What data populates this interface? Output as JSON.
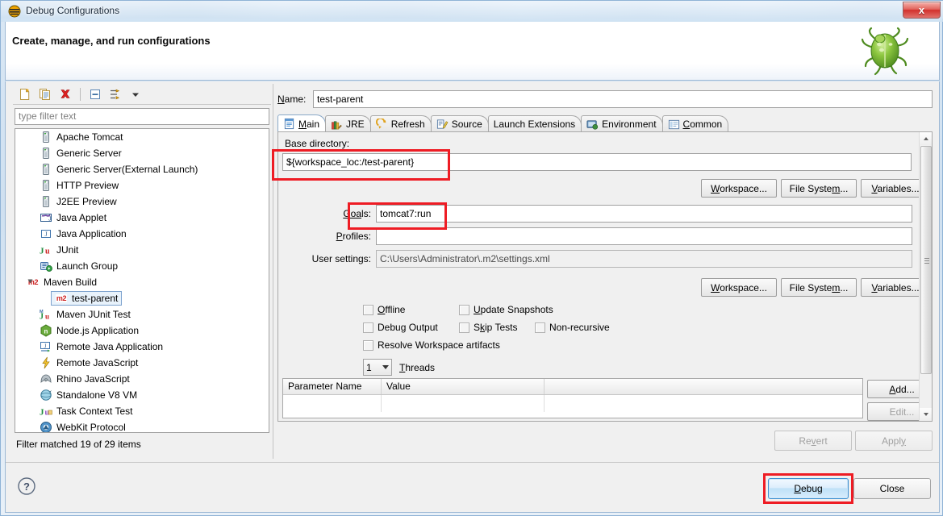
{
  "window": {
    "title": "Debug Configurations",
    "title_icon": "eclipse-debug-icon",
    "close_label": "x"
  },
  "header": {
    "title": "Create, manage, and run configurations",
    "icon": "green-bug-icon"
  },
  "tree_toolbar": {
    "buttons": [
      {
        "name": "new-launch-configuration-icon",
        "label": "New"
      },
      {
        "name": "duplicate-configuration-icon",
        "label": "Duplicate"
      },
      {
        "name": "delete-configuration-icon",
        "label": "Delete"
      },
      {
        "name": "collapse-all-icon",
        "label": "Collapse All"
      },
      {
        "name": "filter-icon",
        "label": "Filter"
      },
      {
        "name": "view-menu-chevron-down-icon",
        "label": "View Menu"
      }
    ]
  },
  "filter": {
    "placeholder": "type filter text",
    "value": ""
  },
  "tree": {
    "items": [
      {
        "label": "Apache Tomcat",
        "icon": "server-icon",
        "level": 0
      },
      {
        "label": "Generic Server",
        "icon": "server-icon",
        "level": 0
      },
      {
        "label": "Generic Server(External Launch)",
        "icon": "server-icon",
        "level": 0
      },
      {
        "label": "HTTP Preview",
        "icon": "server-icon",
        "level": 0
      },
      {
        "label": "J2EE Preview",
        "icon": "server-icon",
        "level": 0
      },
      {
        "label": "Java Applet",
        "icon": "java-applet-icon",
        "level": 0
      },
      {
        "label": "Java Application",
        "icon": "java-application-icon",
        "level": 0
      },
      {
        "label": "JUnit",
        "icon": "junit-icon",
        "level": 0
      },
      {
        "label": "Launch Group",
        "icon": "launch-group-icon",
        "level": 0
      },
      {
        "label": "Maven Build",
        "icon": "maven-icon",
        "level": 0,
        "expanded": true
      },
      {
        "label": "test-parent",
        "icon": "maven-icon",
        "level": 1,
        "selected": true
      },
      {
        "label": "Maven JUnit Test",
        "icon": "maven-junit-icon",
        "level": 0
      },
      {
        "label": "Node.js Application",
        "icon": "nodejs-icon",
        "level": 0
      },
      {
        "label": "Remote Java Application",
        "icon": "remote-java-icon",
        "level": 0
      },
      {
        "label": "Remote JavaScript",
        "icon": "remote-javascript-icon",
        "level": 0
      },
      {
        "label": "Rhino JavaScript",
        "icon": "rhino-icon",
        "level": 0
      },
      {
        "label": "Standalone V8 VM",
        "icon": "v8-vm-icon",
        "level": 0
      },
      {
        "label": "Task Context Test",
        "icon": "task-context-junit-icon",
        "level": 0
      },
      {
        "label": "WebKit Protocol",
        "icon": "webkit-icon",
        "level": 0
      }
    ],
    "status": "Filter matched 19 of 29 items"
  },
  "config": {
    "name_label": "Name:",
    "name_value": "test-parent",
    "tabs": [
      {
        "label": "Main",
        "icon": "main-tab-icon",
        "active": true,
        "mnemonic": "M"
      },
      {
        "label": "JRE",
        "icon": "jre-tab-icon",
        "active": false
      },
      {
        "label": "Refresh",
        "icon": "refresh-tab-icon",
        "active": false
      },
      {
        "label": "Source",
        "icon": "source-tab-icon",
        "active": false
      },
      {
        "label": "Launch Extensions",
        "icon": "",
        "active": false
      },
      {
        "label": "Environment",
        "icon": "environment-tab-icon",
        "active": false
      },
      {
        "label": "Common",
        "icon": "common-tab-icon",
        "active": false
      }
    ],
    "main": {
      "base_directory_label": "Base directory:",
      "base_directory_value": "${workspace_loc:/test-parent}",
      "base_dir_buttons": [
        "Workspace...",
        "File System...",
        "Variables..."
      ],
      "goals_label": "Goals:",
      "goals_value": "tomcat7:run",
      "profiles_label": "Profiles:",
      "profiles_value": "",
      "user_settings_label": "User settings:",
      "user_settings_value": "C:\\Users\\Administrator\\.m2\\settings.xml",
      "user_settings_buttons": [
        "Workspace...",
        "File System...",
        "Variables..."
      ],
      "checkboxes": [
        {
          "label": "Offline",
          "checked": false
        },
        {
          "label": "Update Snapshots",
          "checked": false
        },
        {
          "label": "Debug Output",
          "checked": false
        },
        {
          "label": "Skip Tests",
          "checked": false
        },
        {
          "label": "Non-recursive",
          "checked": false
        },
        {
          "label": "Resolve Workspace artifacts",
          "checked": false
        }
      ],
      "threads_value": "1",
      "threads_label": "Threads",
      "table_headers": [
        "Parameter Name",
        "Value"
      ],
      "table_rows": [],
      "table_buttons": [
        "Add...",
        "Edit..."
      ]
    }
  },
  "footer": {
    "revert_label": "Revert",
    "apply_label": "Apply",
    "debug_label": "Debug",
    "close_label": "Close",
    "help_icon": "help-question-icon"
  },
  "annotations": {
    "accent_red": "#ee1c24",
    "highlighted": [
      "base-directory-input",
      "goals-input",
      "debug-button"
    ]
  }
}
